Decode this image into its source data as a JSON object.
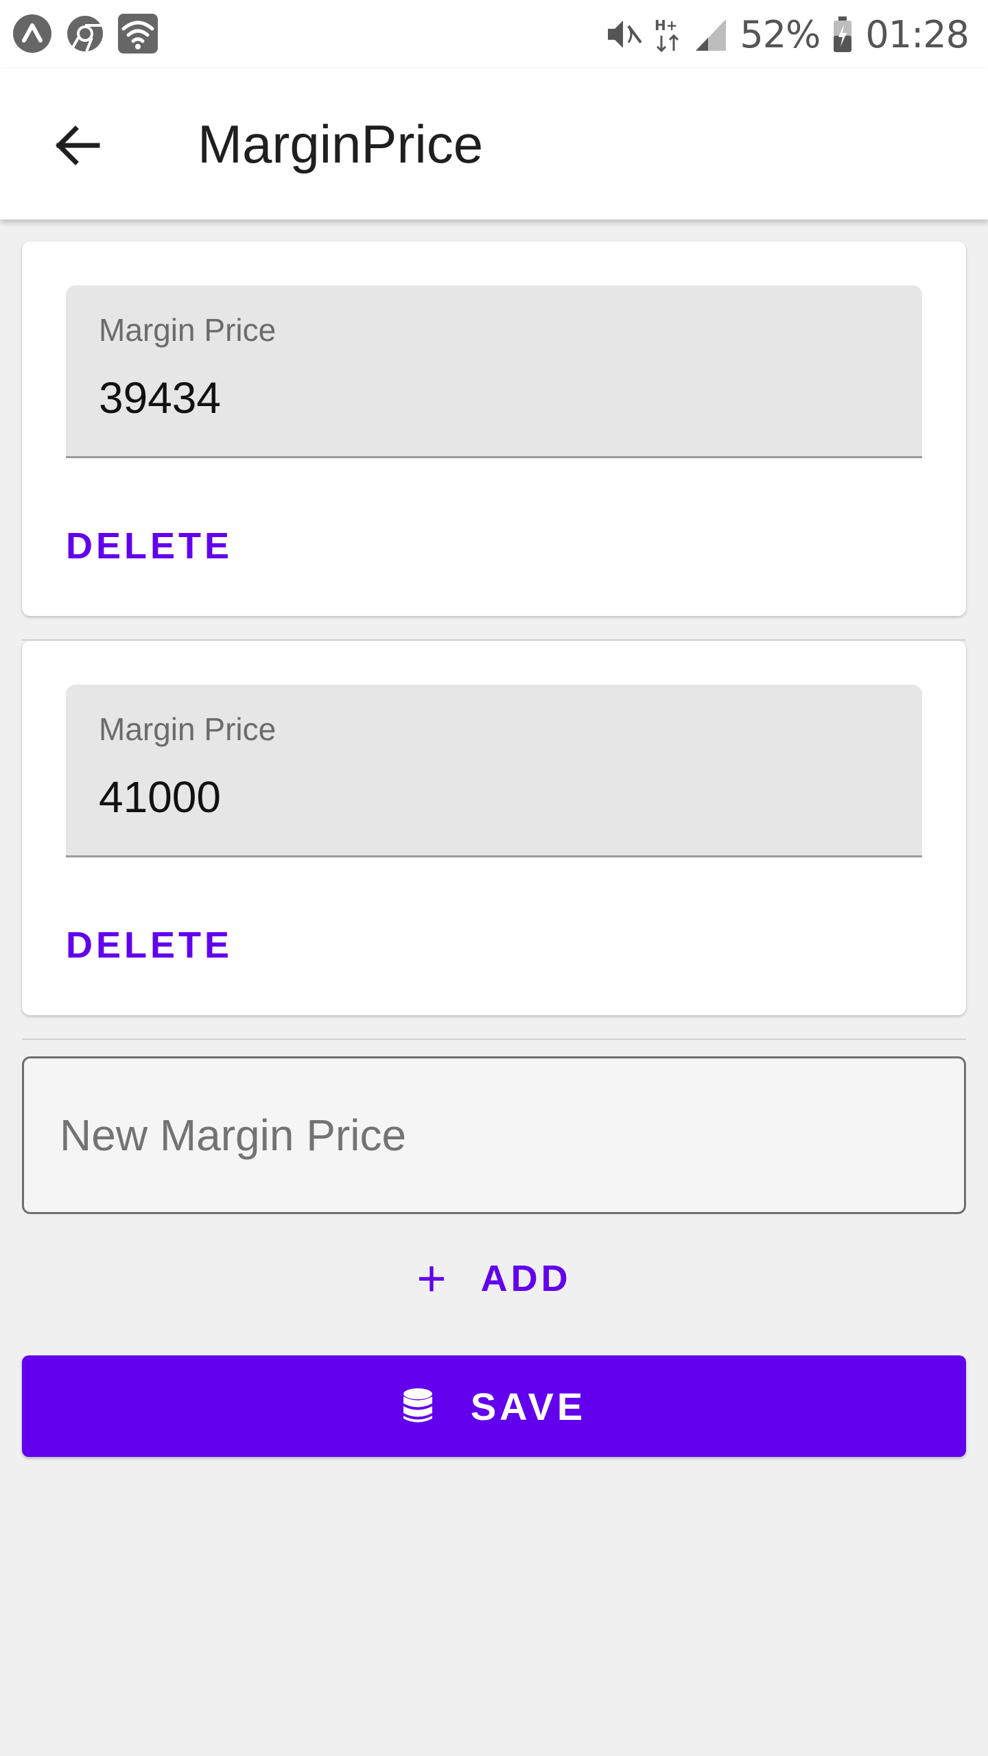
{
  "status_bar": {
    "left_icons": [
      "expo-icon",
      "chrome-icon",
      "wifi-icon"
    ],
    "right_icons": [
      "mute-icon",
      "hplus-data-icon",
      "signal-icon",
      "battery-icon"
    ],
    "battery_percent": "52%",
    "time": "01:28"
  },
  "app_bar": {
    "title": "MarginPrice",
    "back_icon": "arrow-back-icon"
  },
  "items": [
    {
      "label": "Margin Price",
      "value": "39434",
      "delete_label": "DELETE"
    },
    {
      "label": "Margin Price",
      "value": "41000",
      "delete_label": "DELETE"
    }
  ],
  "new_price": {
    "placeholder": "New Margin Price",
    "value": ""
  },
  "add_button": {
    "icon": "+",
    "label": "ADD"
  },
  "save_button": {
    "icon": "database-icon",
    "label": "SAVE"
  },
  "colors": {
    "accent": "#6200ee",
    "background": "#f0f0f0",
    "field_fill": "#e6e6e6"
  }
}
